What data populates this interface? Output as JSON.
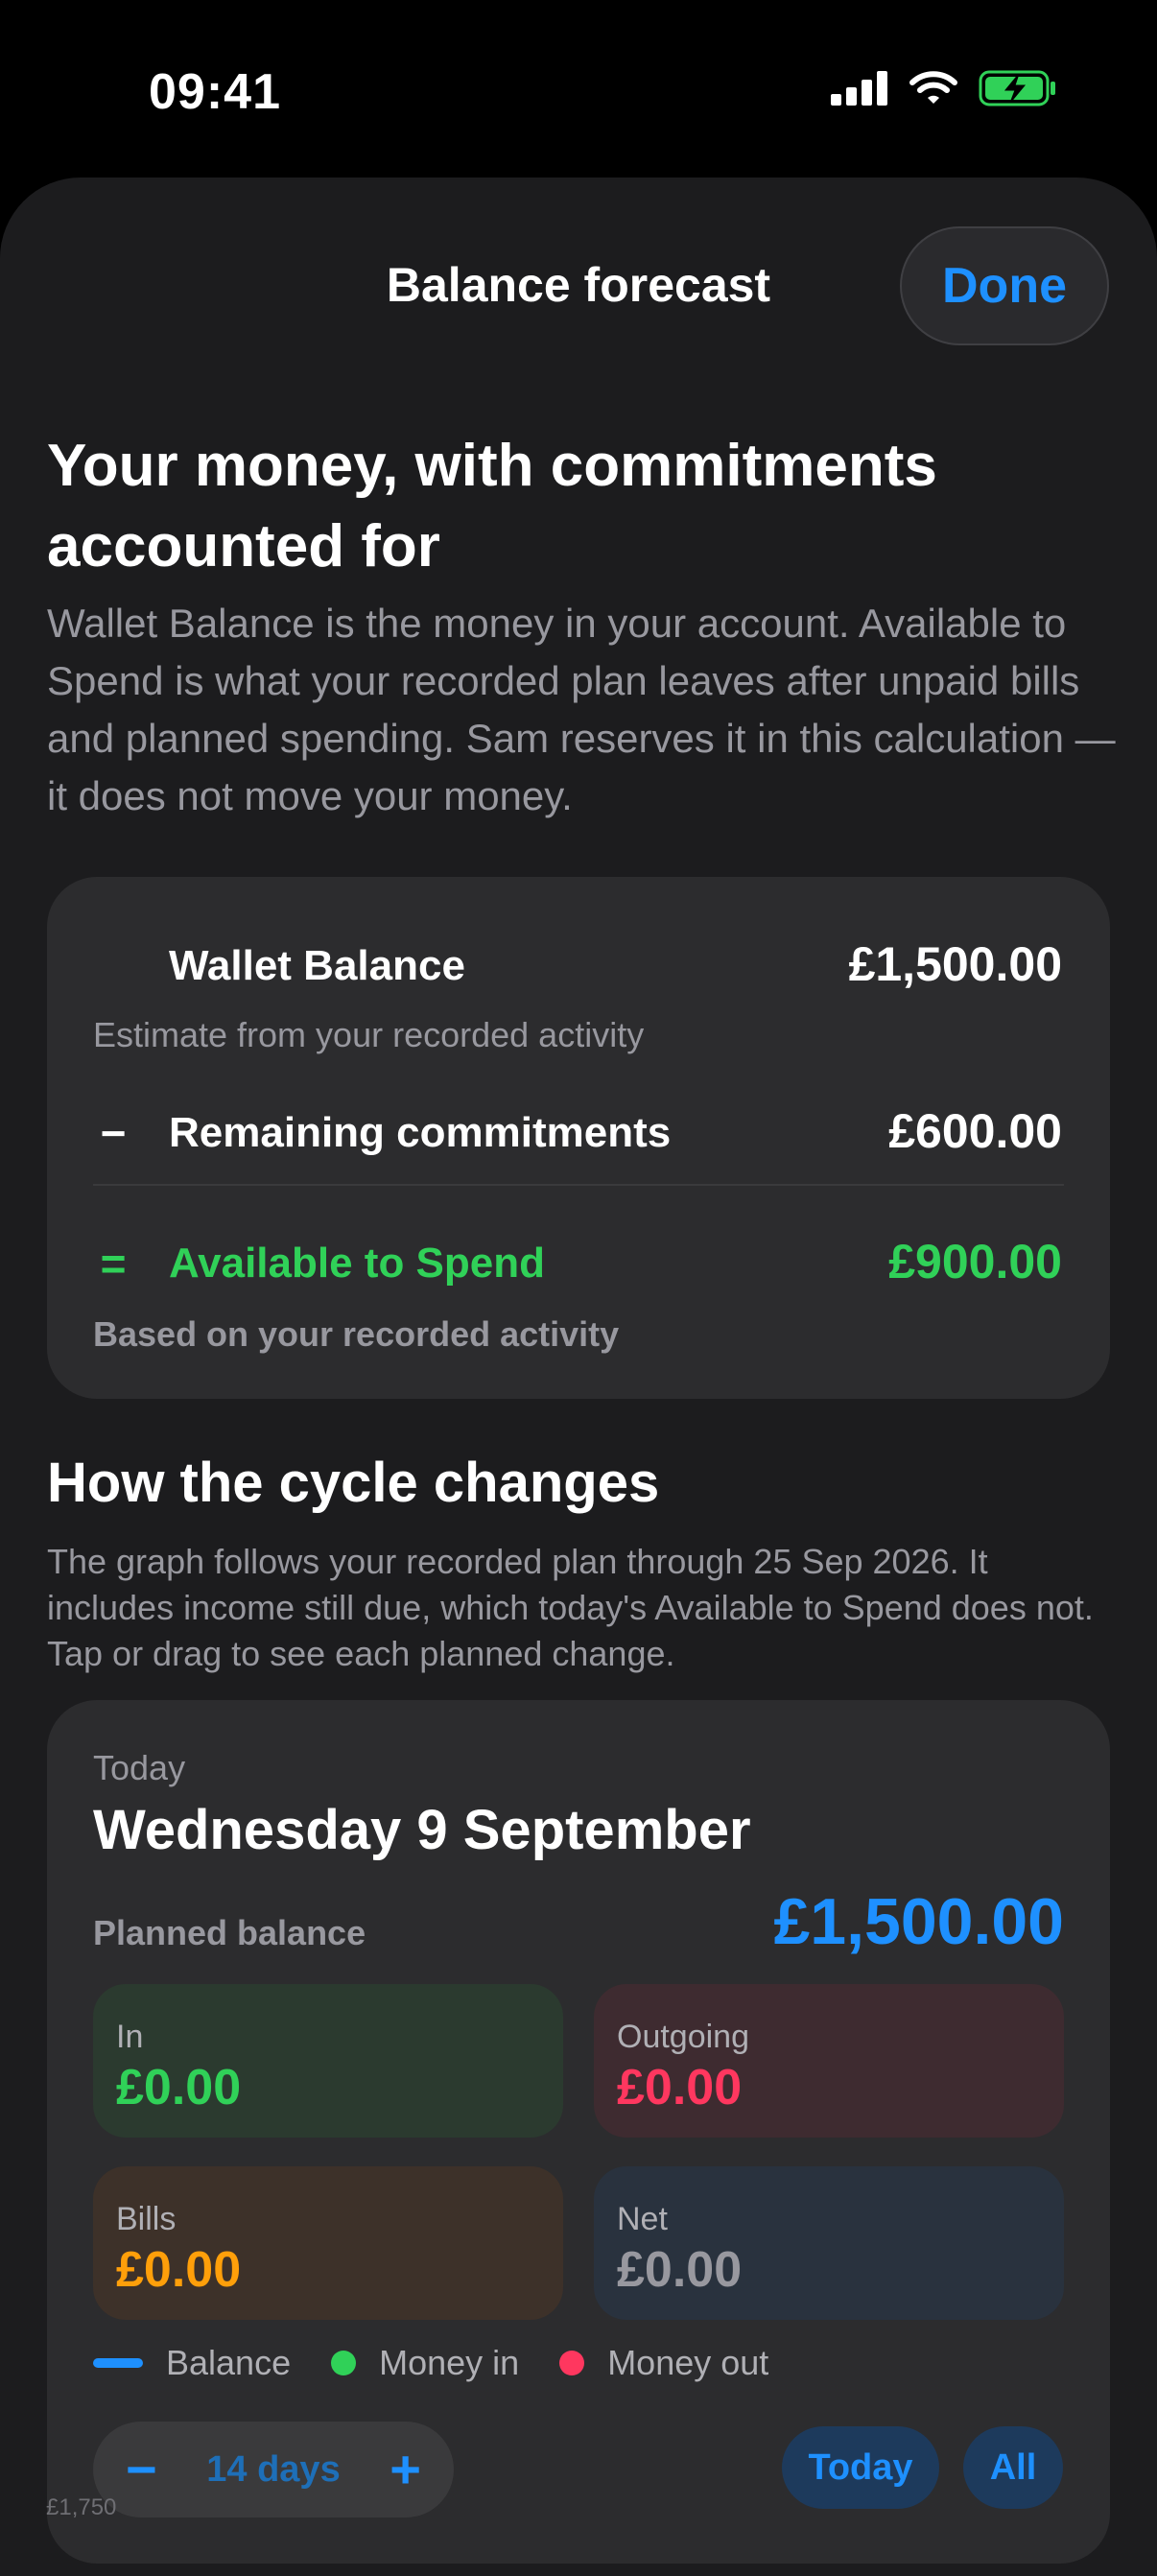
{
  "status_bar": {
    "time": "09:41"
  },
  "header": {
    "title": "Balance forecast",
    "done_label": "Done"
  },
  "intro": {
    "heading": "Your money, with commitments accounted for",
    "body": "Wallet Balance is the money in your account. Available to Spend is what your recorded plan leaves after unpaid bills and planned spending. Sam reserves it in this calculation — it does not move your money."
  },
  "summary": {
    "wallet_label": "Wallet Balance",
    "wallet_value": "£1,500.00",
    "wallet_note": "Estimate from your recorded activity",
    "commit_symbol": "−",
    "commit_label": "Remaining commitments",
    "commit_value": "£600.00",
    "avail_symbol": "=",
    "avail_label": "Available to Spend",
    "avail_value": "£900.00",
    "avail_note": "Based on your recorded activity"
  },
  "cycle": {
    "heading": "How the cycle changes",
    "description": "The graph follows your recorded plan through 25 Sep 2026. It includes income still due, which today's Available to Spend does not. Tap or drag to see each planned change."
  },
  "forecast": {
    "today_label": "Today",
    "date": "Wednesday 9 September",
    "planned_label": "Planned balance",
    "planned_value": "£1,500.00",
    "tiles": {
      "in": {
        "label": "In",
        "value": "£0.00"
      },
      "outgoing": {
        "label": "Outgoing",
        "value": "£0.00"
      },
      "bills": {
        "label": "Bills",
        "value": "£0.00"
      },
      "net": {
        "label": "Net",
        "value": "£0.00"
      }
    },
    "legend": {
      "balance": "Balance",
      "money_in": "Money in",
      "money_out": "Money out"
    },
    "range": {
      "minus": "−",
      "label": "14 days",
      "plus": "+"
    },
    "today_button": "Today",
    "all_button": "All",
    "axis_peek": "£1,750"
  },
  "colors": {
    "accent_blue": "#1e90ff",
    "green": "#30d158",
    "red": "#ff375f",
    "orange": "#ff9f0a",
    "battery_green": "#30d158"
  }
}
